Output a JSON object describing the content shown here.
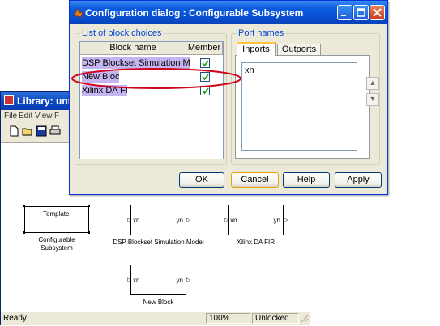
{
  "library": {
    "title": "Library: unti",
    "menu": [
      "File",
      "Edit",
      "View",
      "F"
    ],
    "status": {
      "ready": "Ready",
      "zoom": "100%",
      "lock": "Unlocked"
    },
    "blocks": {
      "template": {
        "title": "Template",
        "caption_line1": "Configurable",
        "caption_line2": "Subsystem"
      },
      "dsp": {
        "in": "xn",
        "out": "yn",
        "caption": "DSP Blockset Simulation Model"
      },
      "xilinx": {
        "in": "xn",
        "out": "yn",
        "caption": "Xilinx DA FIR"
      },
      "newblock": {
        "in": "xn",
        "out": "yn",
        "caption": "New Block"
      }
    }
  },
  "dialog": {
    "title": "Configuration dialog : Configurable Subsystem",
    "choices_group": "List of block choices",
    "columns": {
      "name": "Block name",
      "member": "Member"
    },
    "rows": [
      {
        "name": "DSP Blockset Simulation Model",
        "member": true
      },
      {
        "name": "New Block",
        "member": true
      },
      {
        "name": "Xilinx DA FIR",
        "member": true
      }
    ],
    "ports_group": "Port names",
    "tabs": {
      "inports": "Inports",
      "outports": "Outports"
    },
    "inports_text": "xn",
    "buttons": {
      "ok": "OK",
      "cancel": "Cancel",
      "help": "Help",
      "apply": "Apply"
    }
  },
  "colors": {
    "titlebar": "#0a4fd0",
    "highlight": "#c4b4f0",
    "annotation": "#d0021b",
    "legend": "#0046d5"
  }
}
